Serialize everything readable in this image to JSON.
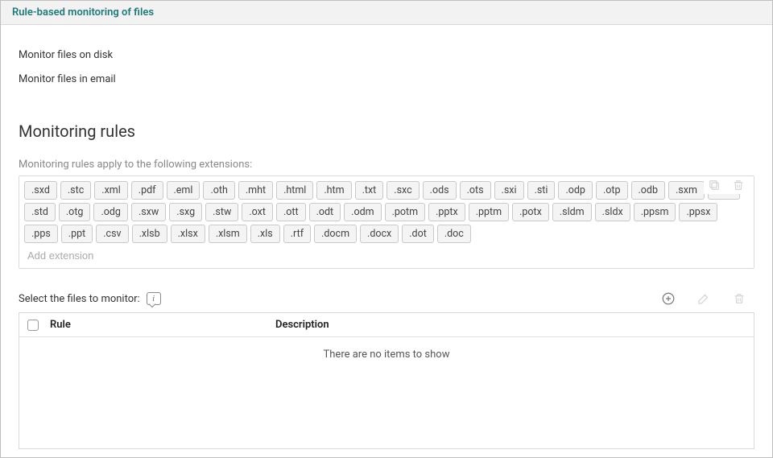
{
  "header": {
    "title": "Rule-based monitoring of files"
  },
  "toggles": {
    "disk_label": "Monitor files on disk",
    "email_label": "Monitor files in email"
  },
  "rules": {
    "title": "Monitoring rules",
    "hint": "Monitoring rules apply to the following extensions:",
    "extensions": [
      ".sxd",
      ".stc",
      ".xml",
      ".pdf",
      ".eml",
      ".oth",
      ".mht",
      ".html",
      ".htm",
      ".txt",
      ".sxc",
      ".ods",
      ".ots",
      ".sxi",
      ".sti",
      ".odp",
      ".otp",
      ".odb",
      ".sxm",
      ".odf",
      ".std",
      ".otg",
      ".odg",
      ".sxw",
      ".sxg",
      ".stw",
      ".oxt",
      ".ott",
      ".odt",
      ".odm",
      ".potm",
      ".pptx",
      ".pptm",
      ".potx",
      ".sldm",
      ".sldx",
      ".ppsm",
      ".ppsx",
      ".pps",
      ".ppt",
      ".csv",
      ".xlsb",
      ".xlsx",
      ".xlsm",
      ".xls",
      ".rtf",
      ".docm",
      ".docx",
      ".dot",
      ".doc"
    ],
    "add_placeholder": "Add extension"
  },
  "files": {
    "label": "Select the files to monitor:",
    "columns": {
      "rule": "Rule",
      "description": "Description"
    },
    "empty": "There are no items to show"
  }
}
